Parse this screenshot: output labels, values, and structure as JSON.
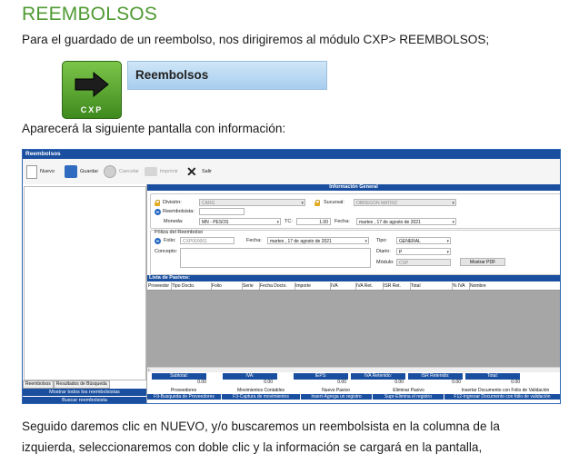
{
  "document": {
    "heading": "REEMBOLSOS",
    "intro": "Para el guardado de un reembolso, nos dirigiremos al módulo CXP> REEMBOLSOS;",
    "banner": {
      "module_label": "CXP",
      "menu_label": "Reembolsos",
      "icon": "arrow-right-icon"
    },
    "screen_intro": "Aparecerá la siguiente pantalla con información:",
    "outro_line1": "Seguido daremos clic en NUEVO, y/o buscaremos un reembolsista en la columna de la",
    "outro_line2": "izquierda, seleccionaremos con doble clic y la información se cargará en la pantalla,"
  },
  "app": {
    "title": "Reembolsos",
    "toolbar": {
      "nuevo": "Nuevo",
      "guardar": "Guardar",
      "cancelar": "Cancelar",
      "imprimir": "Imprimir",
      "salir": "Salir"
    },
    "left_panel": {
      "tabs": [
        "Reembolsos",
        "Resultados de Búsqueda"
      ],
      "show_all": "Mostrar todos los reembolsistas",
      "second_button": "Buscar reembolsista"
    },
    "info": {
      "header": "Información General",
      "division_label": "División:",
      "division_value": "CARG",
      "sucursal_label": "Sucursal:",
      "sucursal_value": "OBREGON MATRIZ",
      "reembolsista_label": "Reembolsista:",
      "reembolsista_value": "",
      "moneda_label": "Moneda:",
      "moneda_value": "MN - PESOS",
      "tc_label": "TC:",
      "tc_value": "1.00",
      "fecha_label": "Fecha:",
      "fecha_value": "martes , 17 de   agosto   de 2021"
    },
    "poliza": {
      "title": "Póliza del Reembolso",
      "folio_label": "Folio:",
      "folio_value": "CXP000001",
      "fecha_label": "Fecha:",
      "fecha_value": "martes , 17 de    agosto    de 2021",
      "tipo_label": "Tipo:",
      "tipo_value": "GENERAL",
      "concepto_label": "Concepto:",
      "concepto_value": "",
      "diario_label": "Diario:",
      "diario_value": "P",
      "modulo_label": "Módulo:",
      "modulo_value": "CXP",
      "mostrar_pdf": "Mostrar PDF"
    },
    "pasivos": {
      "header": "Lista de Pasivos:",
      "columns": [
        "Proveedor",
        "Tipo Docto.",
        "Folio",
        "Serie",
        "Fecha Docto.",
        "Importe",
        "IVA",
        "IVA Ret.",
        "ISR Ret.",
        "Total",
        "% IVA",
        "Nombre"
      ]
    },
    "totals": {
      "labels": [
        "Subtotal:",
        "IVA:",
        "IEPS:",
        "IVA Retenido:",
        "ISR Retenido:",
        "Total:"
      ],
      "values": [
        "0.00",
        "0.00",
        "0.00",
        "0.00",
        "0.00",
        "0.00"
      ]
    },
    "function_keys": {
      "row1": [
        "Proveedores",
        "Movimientos Contables",
        "Nuevo Pasivo",
        "Eliminar Pasivo",
        "Insertar Documento con Folio de Validación"
      ],
      "row2": [
        "F9-Busqueda de Proveedores",
        "F3-Captura de movimientos",
        "Insert-Agrega un registro",
        "Supr-Elimina el registro",
        "F12-Ingresar Documento con folio de validación"
      ]
    }
  }
}
